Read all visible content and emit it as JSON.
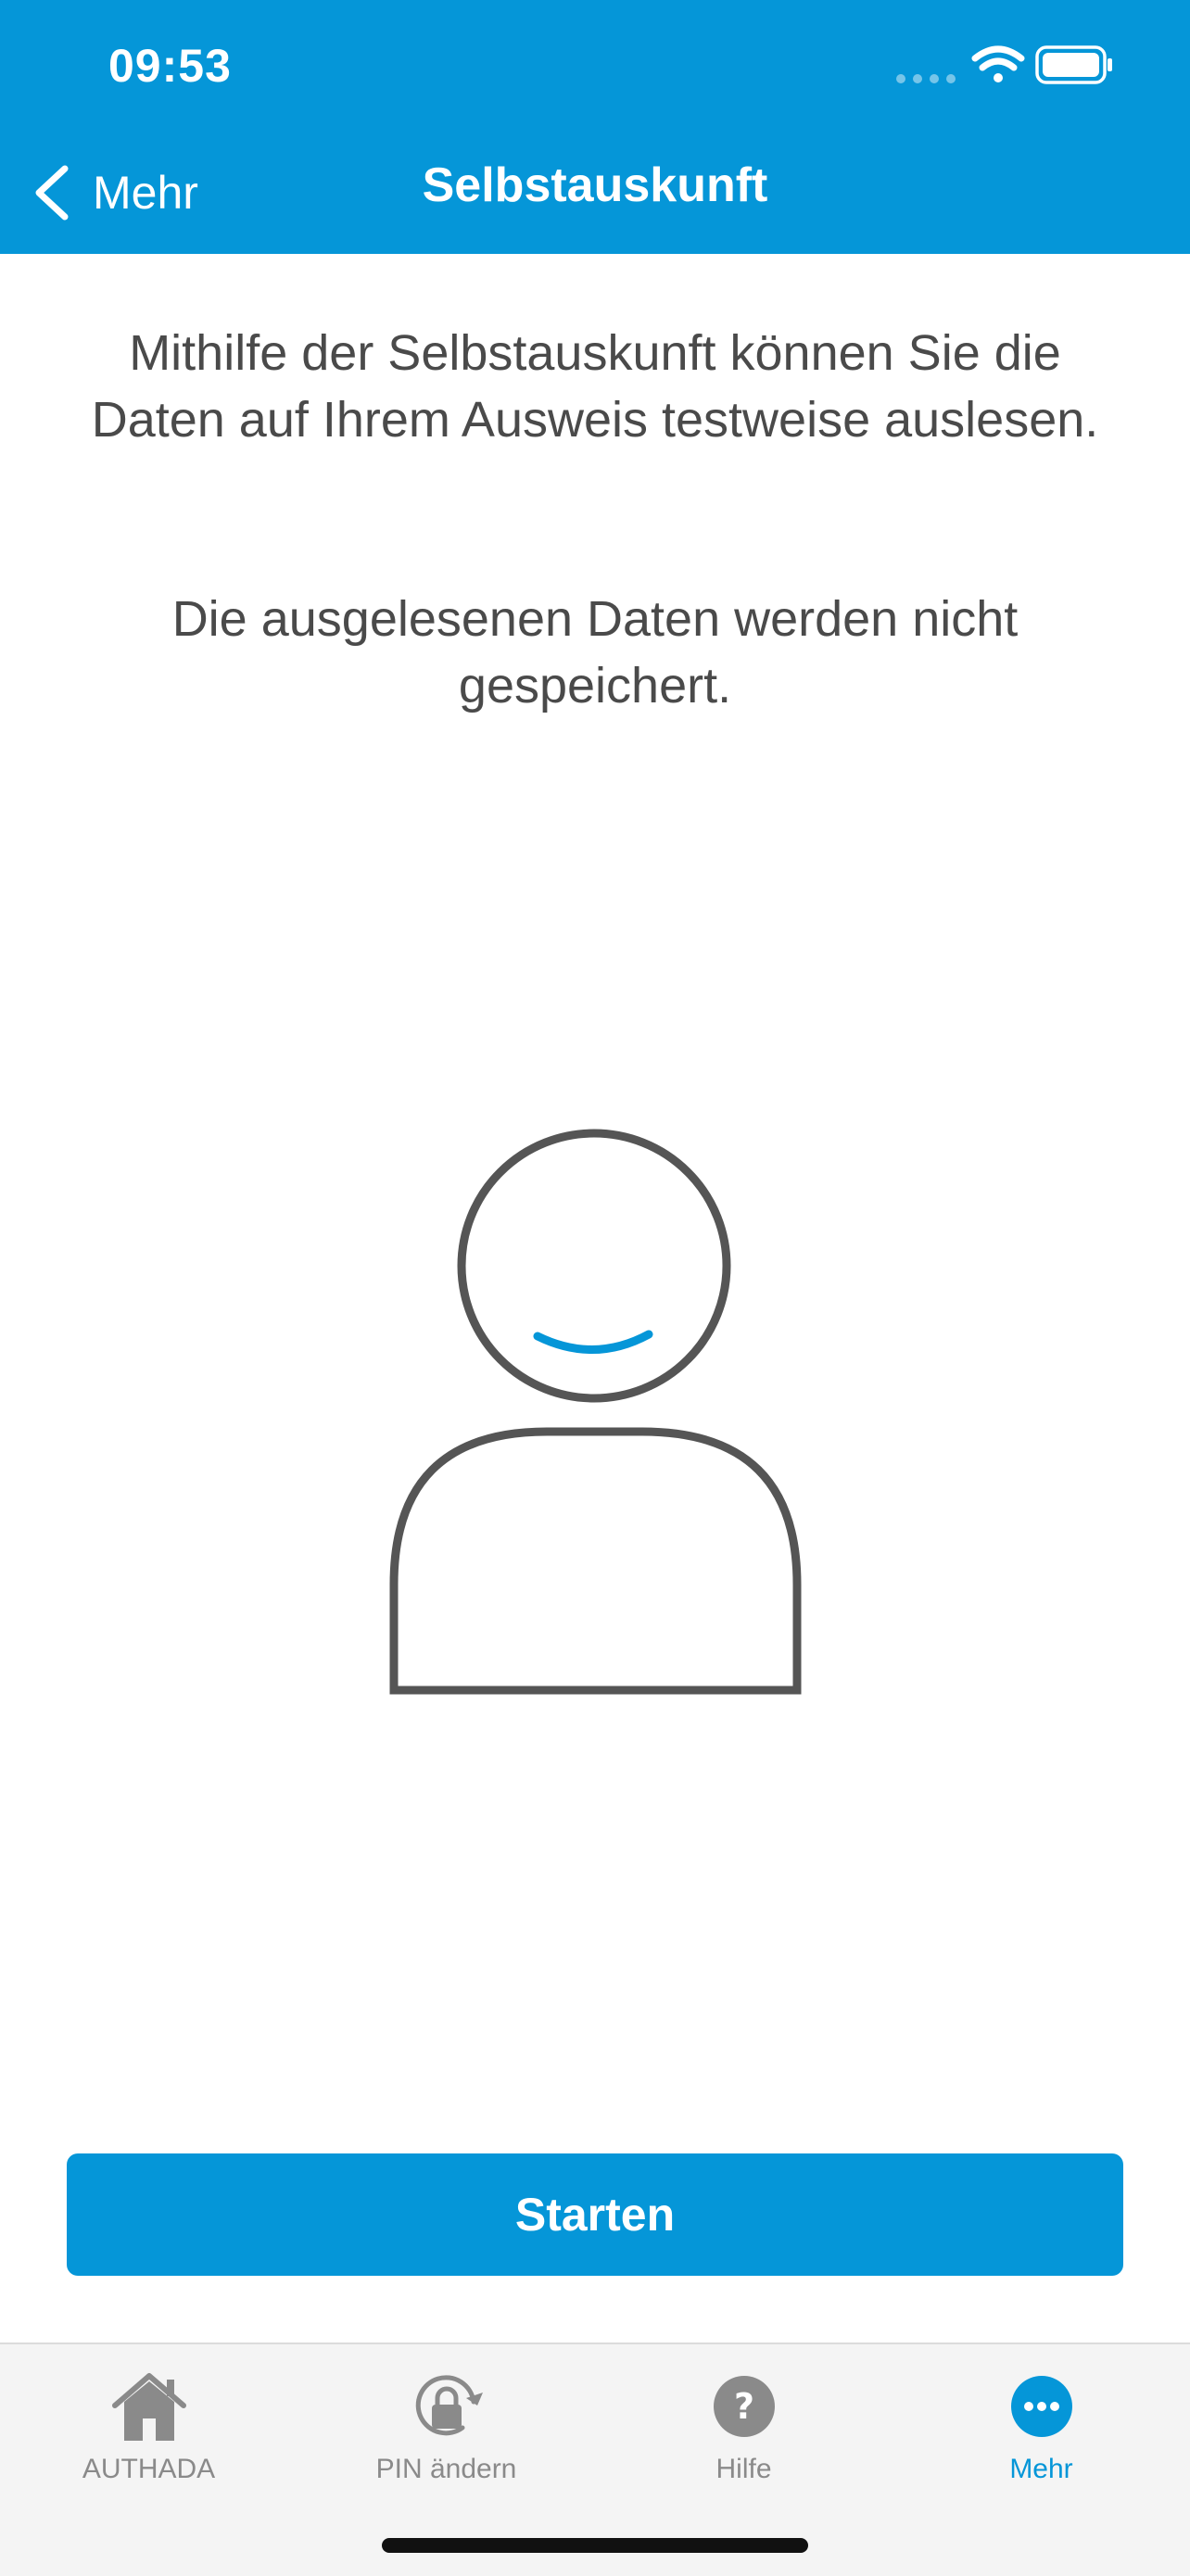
{
  "status_bar": {
    "time": "09:53",
    "icons": [
      "signal-dots-icon",
      "wifi-icon",
      "battery-icon"
    ]
  },
  "nav": {
    "back_label": "Mehr",
    "title": "Selbstauskunft"
  },
  "content": {
    "paragraph1": "Mithilfe der Selbstauskunft können Sie die Daten auf Ihrem Ausweis testweise auslesen.",
    "paragraph2": "Die ausgelesenen Daten werden nicht gespeichert.",
    "illustration": "person-illustration"
  },
  "actions": {
    "start_label": "Starten"
  },
  "tabbar": {
    "items": [
      {
        "label": "AUTHADA",
        "icon": "home-icon",
        "active": false
      },
      {
        "label": "PIN ändern",
        "icon": "lock-refresh-icon",
        "active": false
      },
      {
        "label": "Hilfe",
        "icon": "help-icon",
        "active": false
      },
      {
        "label": "Mehr",
        "icon": "more-icon",
        "active": true
      }
    ]
  },
  "colors": {
    "accent": "#0596d8",
    "text": "#4a4a4a",
    "tab_inactive": "#8a8a8a",
    "tabbar_bg": "#f4f4f4"
  }
}
